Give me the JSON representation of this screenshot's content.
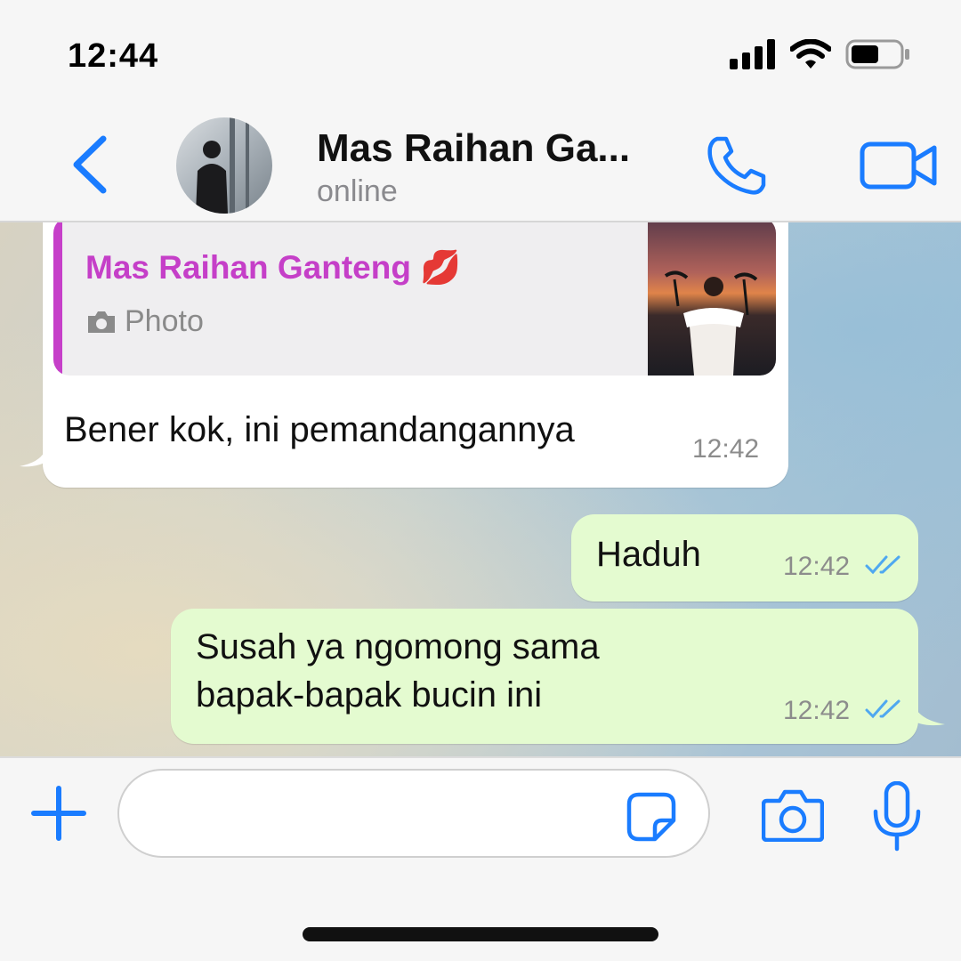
{
  "status_bar": {
    "time": "12:44"
  },
  "header": {
    "contact_name": "Mas Raihan Ga...",
    "contact_status": "online"
  },
  "messages": [
    {
      "direction": "incoming",
      "reply_to": {
        "name": "Mas Raihan Ganteng 💋",
        "type": "Photo"
      },
      "text": "Bener kok, ini pemandangannya",
      "time": "12:42"
    },
    {
      "direction": "outgoing",
      "text": "Haduh",
      "time": "12:42",
      "status": "read"
    },
    {
      "direction": "outgoing",
      "text": "Susah ya ngomong sama bapak-bapak bucin ini",
      "time": "12:42",
      "status": "read"
    }
  ],
  "input": {
    "placeholder": ""
  },
  "colors": {
    "accent": "#1a7cff",
    "outgoing_bubble": "#e4fbd0",
    "incoming_bubble": "#ffffff",
    "quote_name": "#c53fc8",
    "read_ticks": "#4fa8f0"
  },
  "icons": {
    "back": "chevron-left-icon",
    "call": "phone-icon",
    "video": "video-camera-icon",
    "plus": "plus-icon",
    "sticker": "sticker-icon",
    "camera": "camera-icon",
    "mic": "microphone-icon"
  }
}
